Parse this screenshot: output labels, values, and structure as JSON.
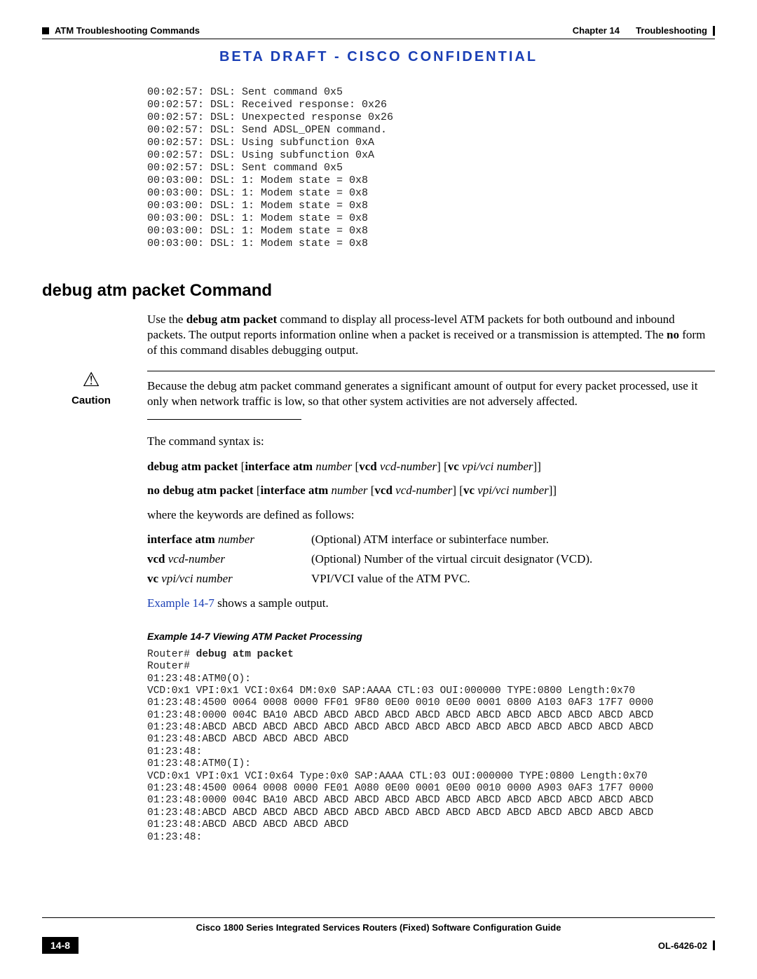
{
  "header": {
    "left_section": "ATM Troubleshooting Commands",
    "right_chapter": "Chapter 14",
    "right_title": "Troubleshooting"
  },
  "banner": "BETA DRAFT - CISCO CONFIDENTIAL",
  "terminal_output": "00:02:57: DSL: Sent command 0x5\n00:02:57: DSL: Received response: 0x26\n00:02:57: DSL: Unexpected response 0x26\n00:02:57: DSL: Send ADSL_OPEN command.\n00:02:57: DSL: Using subfunction 0xA\n00:02:57: DSL: Using subfunction 0xA\n00:02:57: DSL: Sent command 0x5\n00:03:00: DSL: 1: Modem state = 0x8\n00:03:00: DSL: 1: Modem state = 0x8\n00:03:00: DSL: 1: Modem state = 0x8\n00:03:00: DSL: 1: Modem state = 0x8\n00:03:00: DSL: 1: Modem state = 0x8\n00:03:00: DSL: 1: Modem state = 0x8",
  "section_heading": "debug atm packet Command",
  "intro": {
    "pre": "Use the ",
    "cmd": "debug atm packet",
    "mid": " command to display all process-level ATM packets for both outbound and inbound packets. The output reports information online when a packet is received or a transmission is attempted. The ",
    "no": "no",
    "post": " form of this command disables debugging output."
  },
  "caution": {
    "label": "Caution",
    "pre": "Because the ",
    "cmd": "debug atm packet",
    "post": " command generates a significant amount of output for every packet processed, use it only when network traffic is low, so that other system activities are not adversely affected."
  },
  "syntax_intro": "The command syntax is:",
  "syntax_lines": [
    {
      "parts": [
        {
          "t": "debug atm packet",
          "b": true
        },
        {
          "t": " ["
        },
        {
          "t": "interface atm",
          "b": true
        },
        {
          "t": " "
        },
        {
          "t": "number",
          "i": true
        },
        {
          "t": " ["
        },
        {
          "t": "vcd",
          "b": true
        },
        {
          "t": " "
        },
        {
          "t": "vcd-number",
          "i": true
        },
        {
          "t": "] ["
        },
        {
          "t": "vc",
          "b": true
        },
        {
          "t": " "
        },
        {
          "t": "vpi/vci number",
          "i": true
        },
        {
          "t": "]]"
        }
      ]
    },
    {
      "parts": [
        {
          "t": "no debug atm packet",
          "b": true
        },
        {
          "t": " ["
        },
        {
          "t": "interface atm",
          "b": true
        },
        {
          "t": " "
        },
        {
          "t": "number",
          "i": true
        },
        {
          "t": " ["
        },
        {
          "t": "vcd",
          "b": true
        },
        {
          "t": " "
        },
        {
          "t": "vcd-number",
          "i": true
        },
        {
          "t": "] ["
        },
        {
          "t": "vc",
          "b": true
        },
        {
          "t": " "
        },
        {
          "t": "vpi/vci number",
          "i": true
        },
        {
          "t": "]]"
        }
      ]
    }
  ],
  "kw_intro": "where the keywords are defined as follows:",
  "keywords": [
    {
      "kw": "interface atm",
      "arg": "number",
      "desc": "(Optional) ATM interface or subinterface number."
    },
    {
      "kw": "vcd",
      "arg": "vcd-number",
      "desc": "(Optional) Number of the virtual circuit designator (VCD)."
    },
    {
      "kw": "vc",
      "arg": "vpi/vci number",
      "desc": " VPI/VCI value of the ATM PVC."
    }
  ],
  "xref": {
    "link": "Example 14-7",
    "rest": " shows a sample output."
  },
  "example_title": "Example 14-7   Viewing ATM Packet Processing",
  "console": {
    "prompt": "Router# ",
    "cmd": "debug atm packet",
    "body": "Router#\n01:23:48:ATM0(O):\nVCD:0x1 VPI:0x1 VCI:0x64 DM:0x0 SAP:AAAA CTL:03 OUI:000000 TYPE:0800 Length:0x70\n01:23:48:4500 0064 0008 0000 FF01 9F80 0E00 0010 0E00 0001 0800 A103 0AF3 17F7 0000\n01:23:48:0000 004C BA10 ABCD ABCD ABCD ABCD ABCD ABCD ABCD ABCD ABCD ABCD ABCD ABCD\n01:23:48:ABCD ABCD ABCD ABCD ABCD ABCD ABCD ABCD ABCD ABCD ABCD ABCD ABCD ABCD ABCD\n01:23:48:ABCD ABCD ABCD ABCD ABCD\n01:23:48:\n01:23:48:ATM0(I):\nVCD:0x1 VPI:0x1 VCI:0x64 Type:0x0 SAP:AAAA CTL:03 OUI:000000 TYPE:0800 Length:0x70\n01:23:48:4500 0064 0008 0000 FE01 A080 0E00 0001 0E00 0010 0000 A903 0AF3 17F7 0000\n01:23:48:0000 004C BA10 ABCD ABCD ABCD ABCD ABCD ABCD ABCD ABCD ABCD ABCD ABCD ABCD\n01:23:48:ABCD ABCD ABCD ABCD ABCD ABCD ABCD ABCD ABCD ABCD ABCD ABCD ABCD ABCD ABCD\n01:23:48:ABCD ABCD ABCD ABCD ABCD\n01:23:48:"
  },
  "footer": {
    "title": "Cisco 1800 Series Integrated Services Routers (Fixed) Software Configuration Guide",
    "pagenum": "14-8",
    "docnum": "OL-6426-02"
  }
}
